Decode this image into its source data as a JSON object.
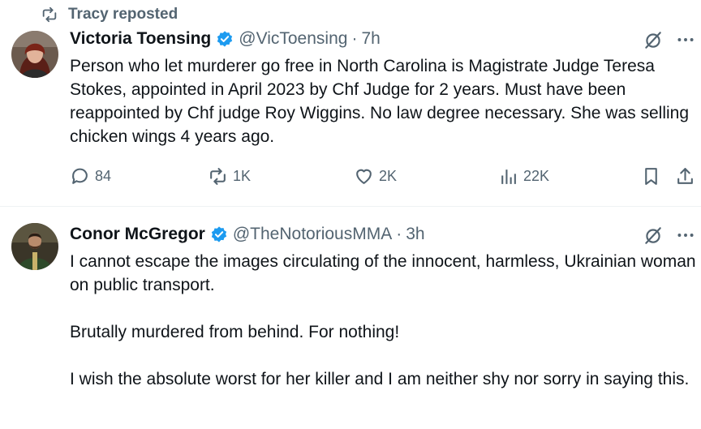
{
  "repost": {
    "label": "Tracy reposted"
  },
  "tweets": [
    {
      "name": "Victoria Toensing",
      "handle": "@VicToensing",
      "time": "7h",
      "paragraphs": [
        "Person who let murderer go free in North Carolina is Magistrate Judge Teresa Stokes, appointed in April 2023 by Chf Judge for 2 years. Must have been reappointed by Chf judge Roy Wiggins. No law degree necessary. She was selling chicken wings 4 years ago."
      ],
      "replies": "84",
      "reposts": "1K",
      "likes": "2K",
      "views": "22K"
    },
    {
      "name": "Conor McGregor",
      "handle": "@TheNotoriousMMA",
      "time": "3h",
      "paragraphs": [
        "I cannot escape the images circulating of the innocent, harmless, Ukrainian woman on public transport.",
        "Brutally murdered from behind. For nothing!",
        "I wish the absolute worst for her killer and I am neither shy nor sorry in saying this."
      ]
    }
  ],
  "separator": "·",
  "colors": {
    "verified": "#1d9bf0",
    "muted": "#536471",
    "text": "#0f1419"
  },
  "icons": {
    "repost": "repost-icon",
    "verified": "verified-badge-icon",
    "grok": "grok-icon",
    "more": "more-icon",
    "reply": "reply-icon",
    "like": "heart-icon",
    "views": "views-icon",
    "bookmark": "bookmark-icon",
    "share": "share-icon"
  }
}
